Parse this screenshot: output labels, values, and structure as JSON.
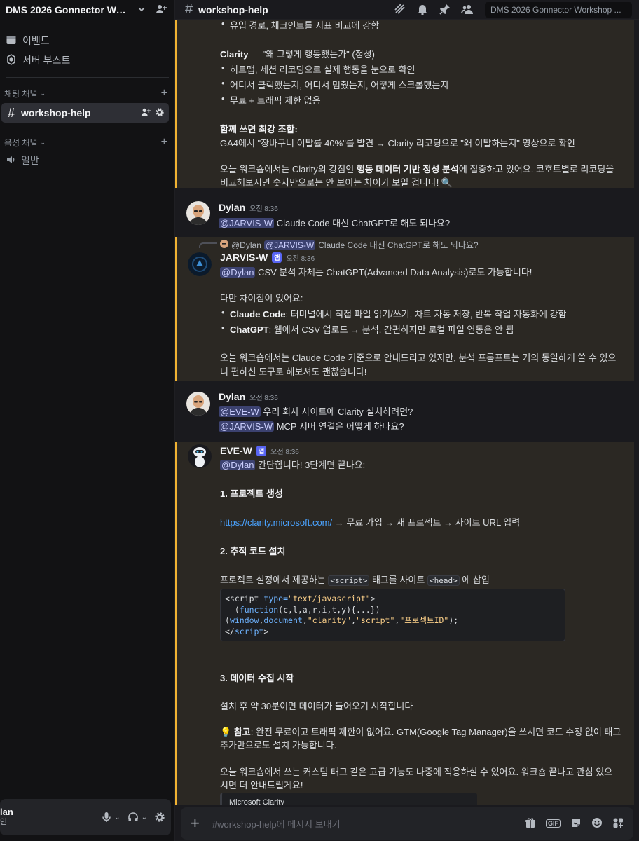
{
  "server": {
    "name": "DMS 2026 Gonnector Workshop"
  },
  "sidebar": {
    "events_label": "이벤트",
    "boost_label": "서버 부스트",
    "text_category": "채팅 채널",
    "voice_category": "음성 채널",
    "active_channel": "workshop-help",
    "voice_channel": "일반"
  },
  "user_panel": {
    "name": "lan",
    "status": "인"
  },
  "topbar": {
    "channel": "workshop-help",
    "search_placeholder": "DMS 2026 Gonnector Workshop ..."
  },
  "messages": {
    "m1": {
      "line0": "유입 경로, 체크인트를 지표 비교에 강함",
      "clarity_title": "Clarity",
      "clarity_sub": " — \"왜 그렇게 행동했는가\" (정성)",
      "b1": "히트맵, 세션 리코딩으로 실제 행동을 눈으로 확인",
      "b2": "어디서 클릭했는지, 어디서 멈췄는지, 어떻게 스크롤했는지",
      "b3": "무료 + 트래픽 제한 없음",
      "combo_title": "함께 쓰면 최강 조합:",
      "combo_text": "GA4에서 \"장바구니 이탈률 40%\"를 발견 → Clarity 리코딩으로 \"왜 이탈하는지\" 영상으로 확인",
      "close1_a": "오늘 워크숍에서는 Clarity의 강점인 ",
      "close1_b": "행동 데이터 기반 정성 분석",
      "close1_c": "에 집중하고 있어요. 코호트별로 리코딩을",
      "close2": "비교해보시면 숫자만으로는 안 보이는 차이가 보일 겁니다! 🔍"
    },
    "m2": {
      "author": "Dylan",
      "time": "오전 8:36",
      "mention": "@JARVIS-W",
      "text": " Claude Code 대신 ChatGPT로 해도 되나요?"
    },
    "m3": {
      "reply_author": "@Dylan",
      "reply_mention": "@JARVIS-W",
      "reply_text": "Claude Code 대신 ChatGPT로 해도 되나요?",
      "author": "JARVIS-W",
      "tag": "앱",
      "time": "오전 8:36",
      "mention": "@Dylan",
      "l1": " CSV 분석 자체는 ChatGPT(Advanced Data Analysis)로도 가능합니다!",
      "l2": "다만 차이점이 있어요:",
      "b1_bold": "Claude Code",
      "b1_text": ": 터미널에서 직접 파일 읽기/쓰기, 차트 자동 저장, 반복 작업 자동화에 강함",
      "b2_bold": "ChatGPT",
      "b2_text": ": 웹에서 CSV 업로드 → 분석. 간편하지만 로컬 파일 연동은 안 됨",
      "l3": "오늘 워크숍에서는 Claude Code 기준으로 안내드리고 있지만, 분석 프롬프트는 거의 동일하게 쓸 수 있으",
      "l4": "니 편하신 도구로 해보셔도 괜찮습니다!"
    },
    "m4": {
      "author": "Dylan",
      "time": "오전 8:36",
      "mention1": "@EVE-W",
      "text1": " 우리 회사 사이트에 Clarity 설치하려면?",
      "mention2": "@JARVIS-W",
      "text2": " MCP 서버 연결은 어떻게 하나요?"
    },
    "m5": {
      "author": "EVE-W",
      "tag": "앱",
      "time": "오전 8:36",
      "mention": "@Dylan",
      "l1": " 간단합니다! 3단계면 끝나요:",
      "h1": "1. 프로젝트 생성",
      "link": "https://clarity.microsoft.com/",
      "l2": " → 무료 가입 → 새 프로젝트 → 사이트 URL 입력",
      "h2": "2. 추적 코드 설치",
      "l3a": "프로젝트 설정에서 제공하는 ",
      "code1": "<script>",
      "l3b": " 태그를 사이트 ",
      "code2": "<head>",
      "l3c": " 에 삽입",
      "h3": "3. 데이터 수집 시작",
      "l4": "설치 후 약 30분이면 데이터가 들어오기 시작합니다",
      "tip_bold": "참고",
      "tip1": ": 완전 무료이고 트래픽 제한이 없어요. GTM(Google Tag Manager)을 쓰시면 코드 수정 없이 태그",
      "tip2": "추가만으로도 설치 가능합니다.",
      "l5": "오늘 워크숍에서 쓰는 커스텀 태그 같은 고급 기능도 나중에 적용하실 수 있어요. 워크숍 끝나고 관심 있으",
      "l6": "시면 더 안내드릴게요!",
      "embed_title": "Microsoft Clarity"
    }
  },
  "code": {
    "c1": "<script ",
    "c2": "type=",
    "c3": "\"text/javascript\"",
    "c4": ">",
    "c5": "  (",
    "c6": "function",
    "c7": "(c,l,a,r,i,t,y){...})",
    "c8": "(",
    "c9": "window",
    "c10": ",",
    "c11": "document",
    "c12": ",",
    "c13": "\"clarity\"",
    "c14": ",",
    "c15": "\"script\"",
    "c16": ",",
    "c17": "\"프로젝트ID\"",
    "c18": ");",
    "c19": "</",
    "c20": "script",
    "c21": ">"
  },
  "composer": {
    "placeholder": "#workshop-help에 메시지 보내기"
  }
}
